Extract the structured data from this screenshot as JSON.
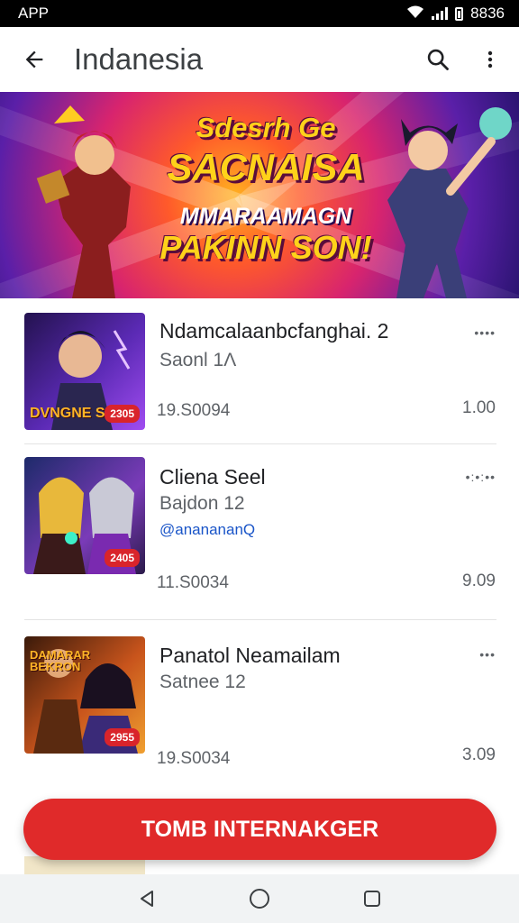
{
  "status_bar": {
    "app_label": "APP",
    "time": "8836"
  },
  "app_bar": {
    "title": "Indanesia"
  },
  "banner": {
    "line1": "Sdesrh Ge",
    "line2": "SACNAISA",
    "line3": "MMARAAMAGN",
    "line4": "PAKINN SON!",
    "indicator_count": 3
  },
  "items": [
    {
      "title": "Ndamcalaanbcfanghai. 2",
      "subtitle": "Saonl 1Ʌ",
      "tag": "",
      "meta": "19.S0094",
      "price": "1.00",
      "more": "••••",
      "thumb_caption": "DVNGNE SUNN",
      "thumb_badge": "2305"
    },
    {
      "title": "Cliena Seel",
      "subtitle": "Bajdon 12",
      "tag": "@ananananQ",
      "meta": "11.S0034",
      "price": "9.09",
      "more": "•:•:••",
      "thumb_caption": "",
      "thumb_badge": "2405"
    },
    {
      "title": "Panatol Neamailam",
      "subtitle": "Satnee 12",
      "tag": "",
      "meta": "19.S0034",
      "price": "3.09",
      "more": "•••",
      "thumb_caption": "DAMARAR BEKRON",
      "thumb_badge": "2955"
    }
  ],
  "cta": {
    "label": "TOMB INTERNAKGER"
  },
  "colors": {
    "accent": "#e02a2a",
    "link": "#1a55c8",
    "badge": "#d9242b"
  },
  "icons": [
    "arrow-back-icon",
    "search-icon",
    "more-vert-icon",
    "wifi-icon",
    "signal-icon",
    "battery-icon",
    "nav-back-icon",
    "nav-home-icon",
    "nav-recents-icon"
  ]
}
